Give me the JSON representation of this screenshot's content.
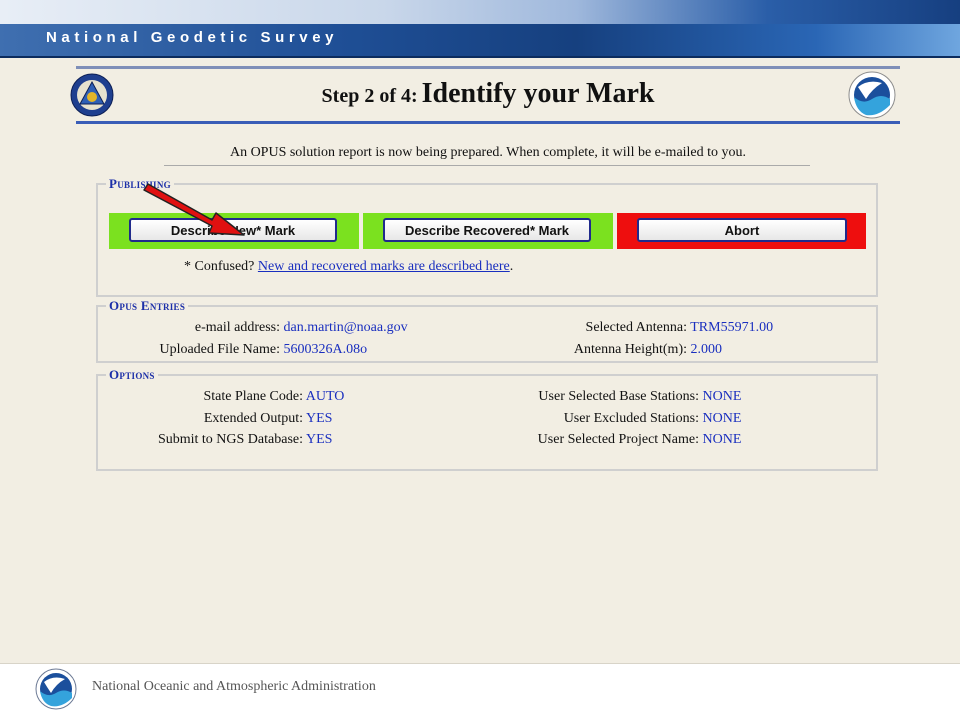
{
  "banner": {
    "title": "National Geodetic Survey"
  },
  "header": {
    "step_prefix": "Step 2 of 4:",
    "step_title": "Identify your Mark"
  },
  "notice": "An OPUS solution report is now being prepared. When complete, it will be e-mailed to you.",
  "publishing": {
    "legend": "Publishing",
    "buttons": {
      "new_mark": "Describe New* Mark",
      "recovered_mark": "Describe Recovered* Mark",
      "abort": "Abort"
    },
    "confused_prefix": "* Confused?",
    "confused_link": "New and recovered marks are described here",
    "confused_suffix": "."
  },
  "opus_entries": {
    "legend": "Opus Entries",
    "email_label": "e-mail address:",
    "email_value": "dan.martin@noaa.gov",
    "file_label": "Uploaded File Name:",
    "file_value": "5600326A.08o",
    "antenna_label": "Selected Antenna:",
    "antenna_value": "TRM55971.00",
    "height_label": "Antenna Height(m):",
    "height_value": "2.000"
  },
  "options": {
    "legend": "Options",
    "spc_label": "State Plane Code:",
    "spc_value": "AUTO",
    "ext_label": "Extended Output:",
    "ext_value": "YES",
    "ngs_label": "Submit to NGS Database:",
    "ngs_value": "YES",
    "base_label": "User Selected Base Stations:",
    "base_value": "NONE",
    "excl_label": "User Excluded Stations:",
    "excl_value": "NONE",
    "proj_label": "User Selected Project Name:",
    "proj_value": "NONE"
  },
  "footer": {
    "text": "National Oceanic and Atmospheric Administration"
  },
  "colors": {
    "accent_blue": "#1a2fbf",
    "green_cell": "#7be11f",
    "red_cell": "#ee0e0e",
    "arrow": "#e01010"
  },
  "icons": [
    "ngs-seal-icon",
    "noaa-logo-icon",
    "red-arrow-icon"
  ]
}
